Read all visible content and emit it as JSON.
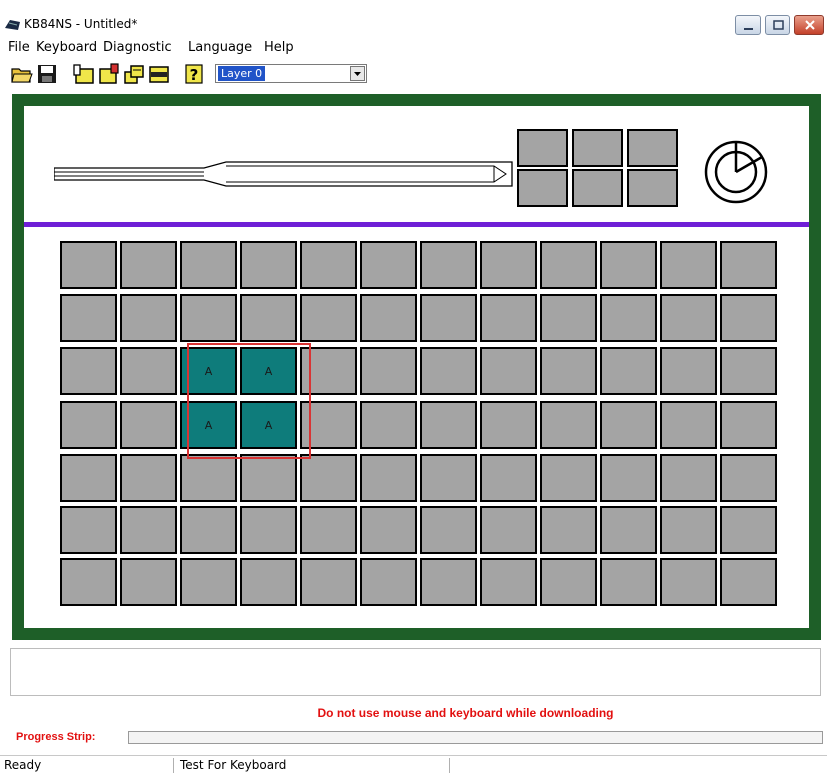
{
  "window": {
    "title": "KB84NS - Untitled*"
  },
  "menu": [
    "File",
    "Keyboard",
    "Diagnostic",
    "Language",
    "Help"
  ],
  "toolbar": {
    "icons": [
      "open-folder-icon",
      "save-disk-icon",
      "keyboard-icon-1",
      "keyboard-icon-2",
      "keyboard-icon-3",
      "keyboard-icon-4",
      "help-icon"
    ],
    "layer_value": "Layer 0"
  },
  "keyboard": {
    "rows": 7,
    "cols": 12,
    "active_keys": [
      {
        "row": 2,
        "col": 2,
        "label": "A"
      },
      {
        "row": 2,
        "col": 3,
        "label": "A"
      },
      {
        "row": 3,
        "col": 2,
        "label": "A"
      },
      {
        "row": 3,
        "col": 3,
        "label": "A"
      }
    ],
    "top_keys_rows": 2,
    "top_keys_cols": 3,
    "colors": {
      "panel_border": "#1e5f28",
      "key_gray": "#a4a4a4",
      "key_active": "#0e7c7b",
      "selection": "#d93434",
      "separator": "#6f1fd6"
    }
  },
  "warning_text": "Do not use mouse and keyboard while downloading",
  "progress": {
    "label": "Progress Strip:",
    "value": 0
  },
  "status": {
    "left": "Ready",
    "middle": "Test For Keyboard",
    "right": ""
  }
}
